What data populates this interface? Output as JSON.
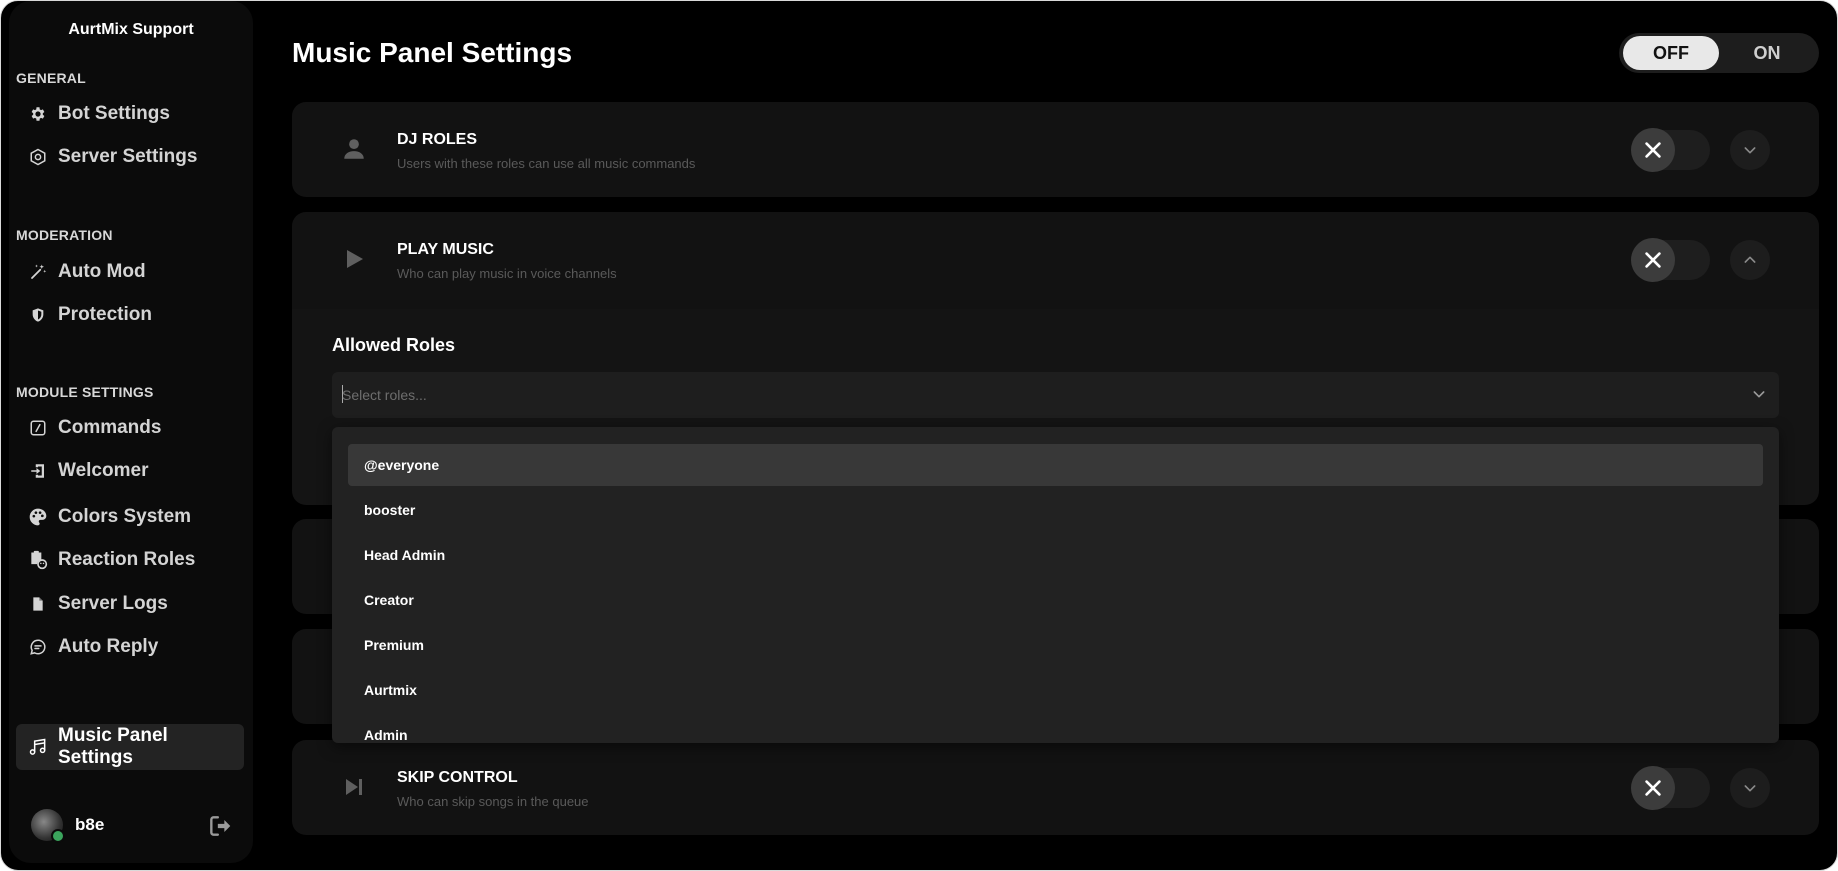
{
  "app": {
    "name": "AurtMix Support"
  },
  "sidebar": {
    "sections": [
      {
        "title": "GENERAL"
      },
      {
        "title": "MODERATION"
      },
      {
        "title": "MODULE SETTINGS"
      }
    ],
    "items": [
      {
        "label": "Bot Settings",
        "icon": "gear-icon"
      },
      {
        "label": "Server Settings",
        "icon": "hexagon-icon"
      },
      {
        "label": "Auto Mod",
        "icon": "magic-wand-icon"
      },
      {
        "label": "Protection",
        "icon": "shield-icon"
      },
      {
        "label": "Commands",
        "icon": "slash-command-icon"
      },
      {
        "label": "Welcomer",
        "icon": "door-enter-icon"
      },
      {
        "label": "Colors System",
        "icon": "palette-icon"
      },
      {
        "label": "Reaction Roles",
        "icon": "reaction-badge-icon"
      },
      {
        "label": "Server Logs",
        "icon": "document-icon"
      },
      {
        "label": "Auto Reply",
        "icon": "chat-bubble-icon"
      },
      {
        "label": "Music Panel Settings",
        "icon": "music-note-icon",
        "active": true
      }
    ],
    "user": {
      "name": "b8e",
      "status": "online"
    }
  },
  "header": {
    "title": "Music Panel Settings",
    "master_toggle": {
      "off_label": "OFF",
      "on_label": "ON",
      "value": "OFF"
    }
  },
  "cards": [
    {
      "title": "DJ ROLES",
      "description": "Users with these roles can use all music commands",
      "icon": "user-icon",
      "enabled": false,
      "expanded": false
    },
    {
      "title": "PLAY MUSIC",
      "description": "Who can play music in voice channels",
      "icon": "play-icon",
      "enabled": false,
      "expanded": true
    },
    {
      "title": "SKIP CONTROL",
      "description": "Who can skip songs in the queue",
      "icon": "skip-forward-icon",
      "enabled": false,
      "expanded": false
    }
  ],
  "play_music_panel": {
    "allowed_roles_label": "Allowed Roles",
    "select_placeholder": "Select roles...",
    "options": [
      "@everyone",
      "booster",
      "Head Admin",
      "Creator",
      "Premium",
      "Aurtmix",
      "Admin"
    ]
  },
  "colors": {
    "background": "#000000",
    "card": "#121212",
    "dropdown": "#222222",
    "highlight": "#383838",
    "online": "#3ba55d"
  }
}
